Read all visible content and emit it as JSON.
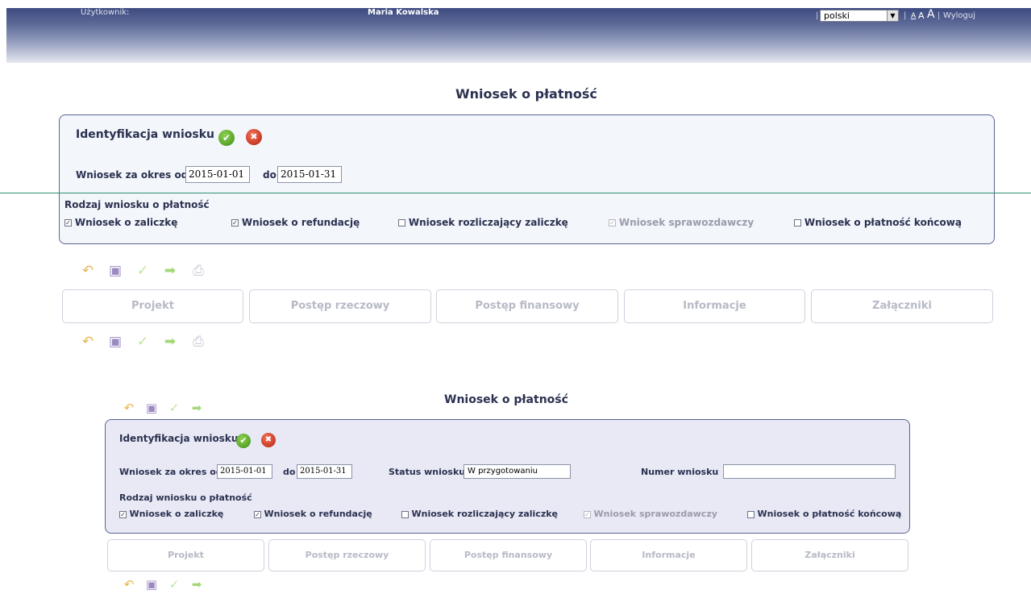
{
  "header": {
    "user_label": "Użytkownik:",
    "user_name": "Maria Kowalska",
    "language": "polski",
    "sep": "|",
    "font_small": "A",
    "font_medium": "A",
    "font_large": "A",
    "logout": "Wyloguj"
  },
  "view1": {
    "title": "Wniosek o płatność",
    "section_title": "Identyfikacja wniosku",
    "period_label": "Wniosek za okres od",
    "date_from": "2015-01-01",
    "to_label": "do",
    "date_to": "2015-01-31",
    "type_label": "Rodzaj wniosku o płatność",
    "checkboxes": [
      {
        "label": "Wniosek o zaliczkę",
        "checked": true,
        "disabled": false
      },
      {
        "label": "Wniosek o refundację",
        "checked": true,
        "disabled": false
      },
      {
        "label": "Wniosek rozliczający zaliczkę",
        "checked": false,
        "disabled": false
      },
      {
        "label": "Wniosek sprawozdawczy",
        "checked": true,
        "disabled": true
      },
      {
        "label": "Wniosek o płatność końcową",
        "checked": false,
        "disabled": false
      }
    ],
    "tabs": [
      "Projekt",
      "Postęp rzeczowy",
      "Postęp finansowy",
      "Informacje",
      "Załączniki"
    ]
  },
  "view2": {
    "title": "Wniosek o płatność",
    "section_title": "Identyfikacja wniosku",
    "period_label": "Wniosek za okres od",
    "date_from": "2015-01-01",
    "to_label": "do",
    "date_to": "2015-01-31",
    "status_label": "Status wniosku",
    "status_value": "W przygotowaniu",
    "number_label": "Numer wniosku",
    "number_value": "",
    "type_label": "Rodzaj wniosku o płatność",
    "checkboxes": [
      {
        "label": "Wniosek o zaliczkę",
        "checked": true,
        "disabled": false
      },
      {
        "label": "Wniosek o refundację",
        "checked": true,
        "disabled": false
      },
      {
        "label": "Wniosek rozliczający zaliczkę",
        "checked": false,
        "disabled": false
      },
      {
        "label": "Wniosek sprawozdawczy",
        "checked": true,
        "disabled": true
      },
      {
        "label": "Wniosek o płatność końcową",
        "checked": false,
        "disabled": false
      }
    ],
    "tabs": [
      "Projekt",
      "Postęp rzeczowy",
      "Postęp finansowy",
      "Informacje",
      "Załączniki"
    ]
  },
  "toolbar_icons": [
    "undo-icon",
    "save-icon",
    "check-icon",
    "next-icon",
    "print-icon"
  ],
  "colors": {
    "accent": "#2b3150",
    "ok": "#4a9b22",
    "cancel": "#c5290f",
    "divider": "#2d8f6e"
  }
}
